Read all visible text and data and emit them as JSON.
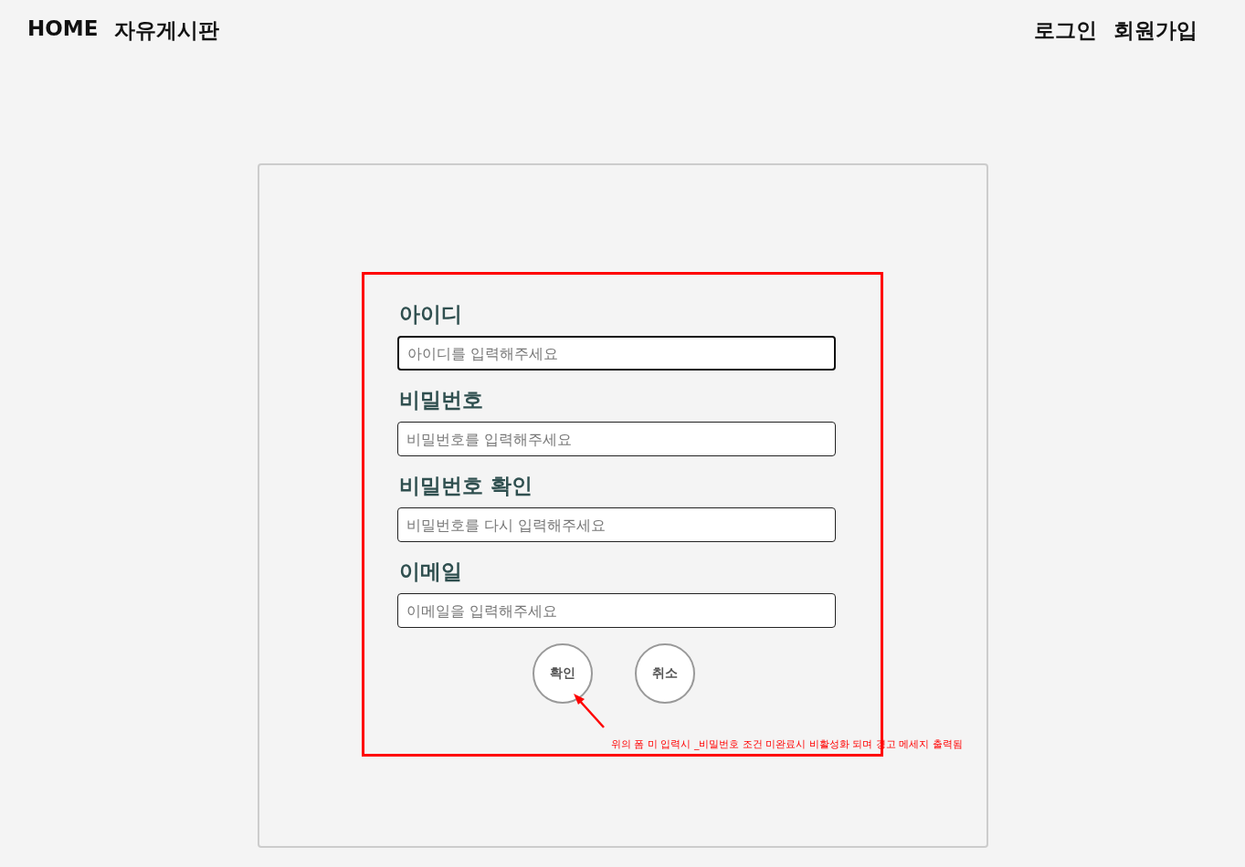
{
  "nav": {
    "left": [
      "HOME",
      "자유게시판"
    ],
    "right": [
      "로그인",
      "회원가입"
    ]
  },
  "form": {
    "fields": [
      {
        "label": "아이디",
        "placeholder": "아이디를 입력해주세요",
        "focused": true
      },
      {
        "label": "비밀번호",
        "placeholder": "비밀번호를 입력해주세요",
        "focused": false
      },
      {
        "label": "비밀번호 확인",
        "placeholder": "비밀번호를 다시 입력해주세요",
        "focused": false
      },
      {
        "label": "이메일",
        "placeholder": "이메일을 입력해주세요",
        "focused": false
      }
    ],
    "buttons": [
      "확인",
      "취소"
    ],
    "annotation": "위의 폼 미 입력시 _비밀번호 조건 미완료시 비활성화 되며 경고 메세지 출력됨"
  }
}
